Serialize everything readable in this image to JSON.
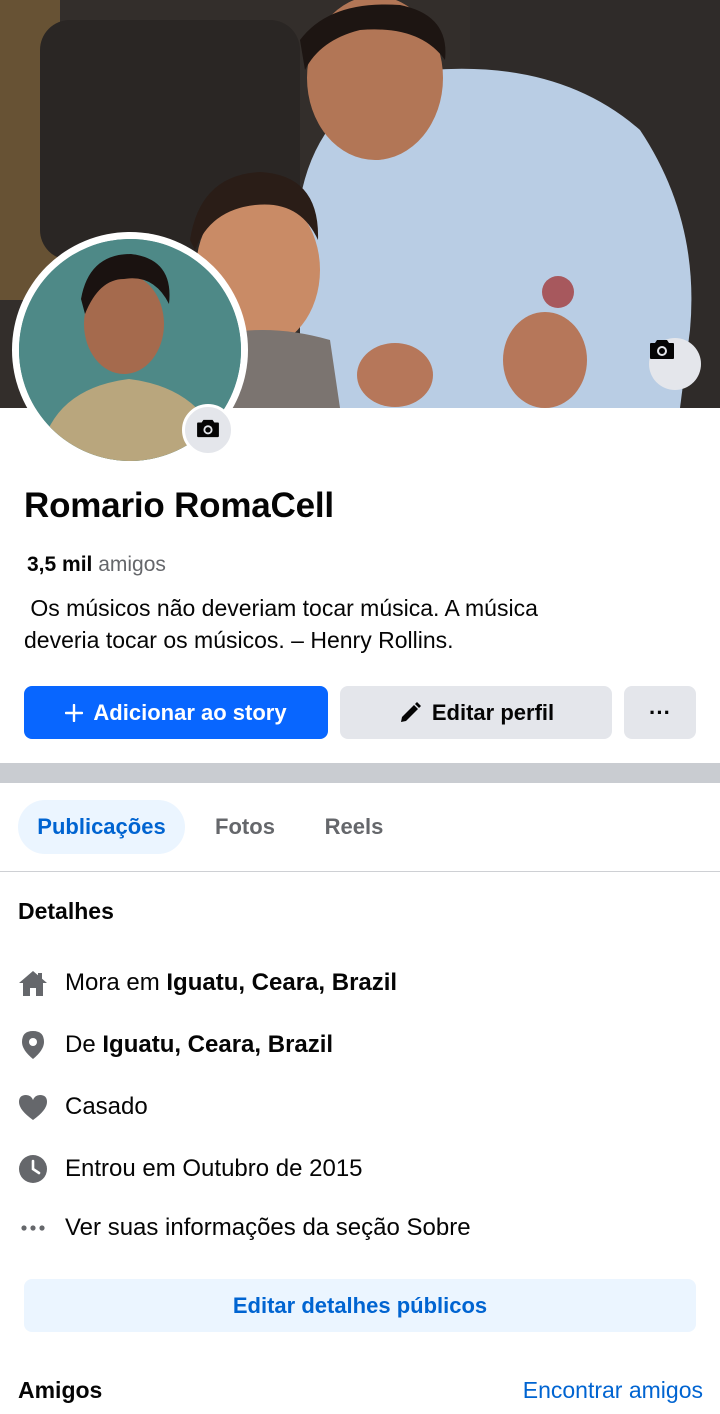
{
  "profile": {
    "name": "Romario RomaCell",
    "friends_count": "3,5 mil",
    "friends_label": "amigos",
    "bio_line1": " Os músicos não deveriam tocar música. A música",
    "bio_line2": "deveria tocar os músicos. – Henry Rollins."
  },
  "actions": {
    "add_story": "Adicionar ao story",
    "edit_profile": "Editar perfil",
    "more": "···"
  },
  "tabs": [
    {
      "label": "Publicações",
      "active": true
    },
    {
      "label": "Fotos",
      "active": false
    },
    {
      "label": "Reels",
      "active": false
    }
  ],
  "details": {
    "title": "Detalhes",
    "lives_prefix": "Mora em",
    "lives_place": "Iguatu, Ceara, Brazil",
    "from_prefix": "De",
    "from_place": "Iguatu, Ceara, Brazil",
    "relationship": "Casado",
    "joined": "Entrou em Outubro de 2015",
    "see_about": "Ver suas informações da seção Sobre",
    "edit_public": "Editar detalhes públicos"
  },
  "friends_section": {
    "title": "Amigos",
    "find_link": "Encontrar amigos"
  },
  "icons": {
    "cover_camera": "camera-icon",
    "avatar_camera": "camera-icon",
    "story_plus": "plus-icon",
    "edit_pencil": "pencil-icon",
    "home": "home-icon",
    "location": "location-pin-icon",
    "relationship": "heart-icon",
    "joined": "clock-icon",
    "more": "more-dots-icon"
  },
  "colors": {
    "primary": "#0866ff",
    "link": "#0064d1",
    "secondary_button": "#e4e6eb",
    "tab_active_bg": "#ebf5ff",
    "icon_gray": "#65676b"
  }
}
